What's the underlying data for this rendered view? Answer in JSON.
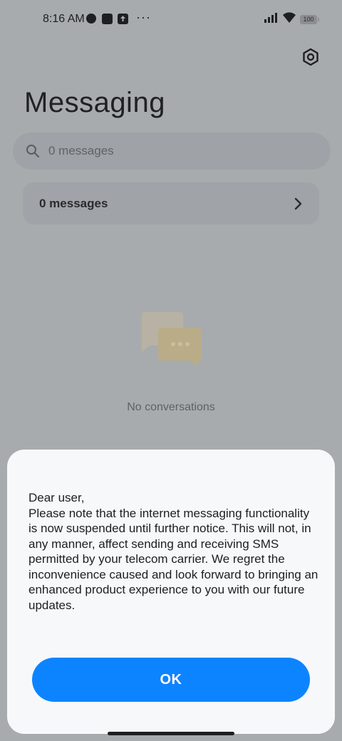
{
  "status_bar": {
    "time": "8:16 AM",
    "more": "···",
    "battery": "100"
  },
  "header": {
    "title": "Messaging"
  },
  "search": {
    "placeholder": "0 messages"
  },
  "messages_card": {
    "label": "0 messages"
  },
  "empty_state": {
    "text": "No conversations"
  },
  "dialog": {
    "message": "Dear user,\nPlease note that the internet messaging functionality is now suspended until further notice. This will not, in any manner, affect sending and receiving SMS permitted by your telecom carrier. We regret the inconvenience caused and look forward to bringing an enhanced product experience to you with our future updates.",
    "ok_label": "OK"
  },
  "colors": {
    "accent": "#0d84ff",
    "scrim_background": "#a8abae",
    "dialog_background": "#f7f8fa"
  },
  "icons": [
    "dot-icon",
    "square-icon",
    "upload-icon",
    "more-icon",
    "signal-icon",
    "wifi-icon",
    "battery-icon",
    "settings-icon",
    "search-icon",
    "chevron-right-icon",
    "chat-bubbles-icon"
  ]
}
